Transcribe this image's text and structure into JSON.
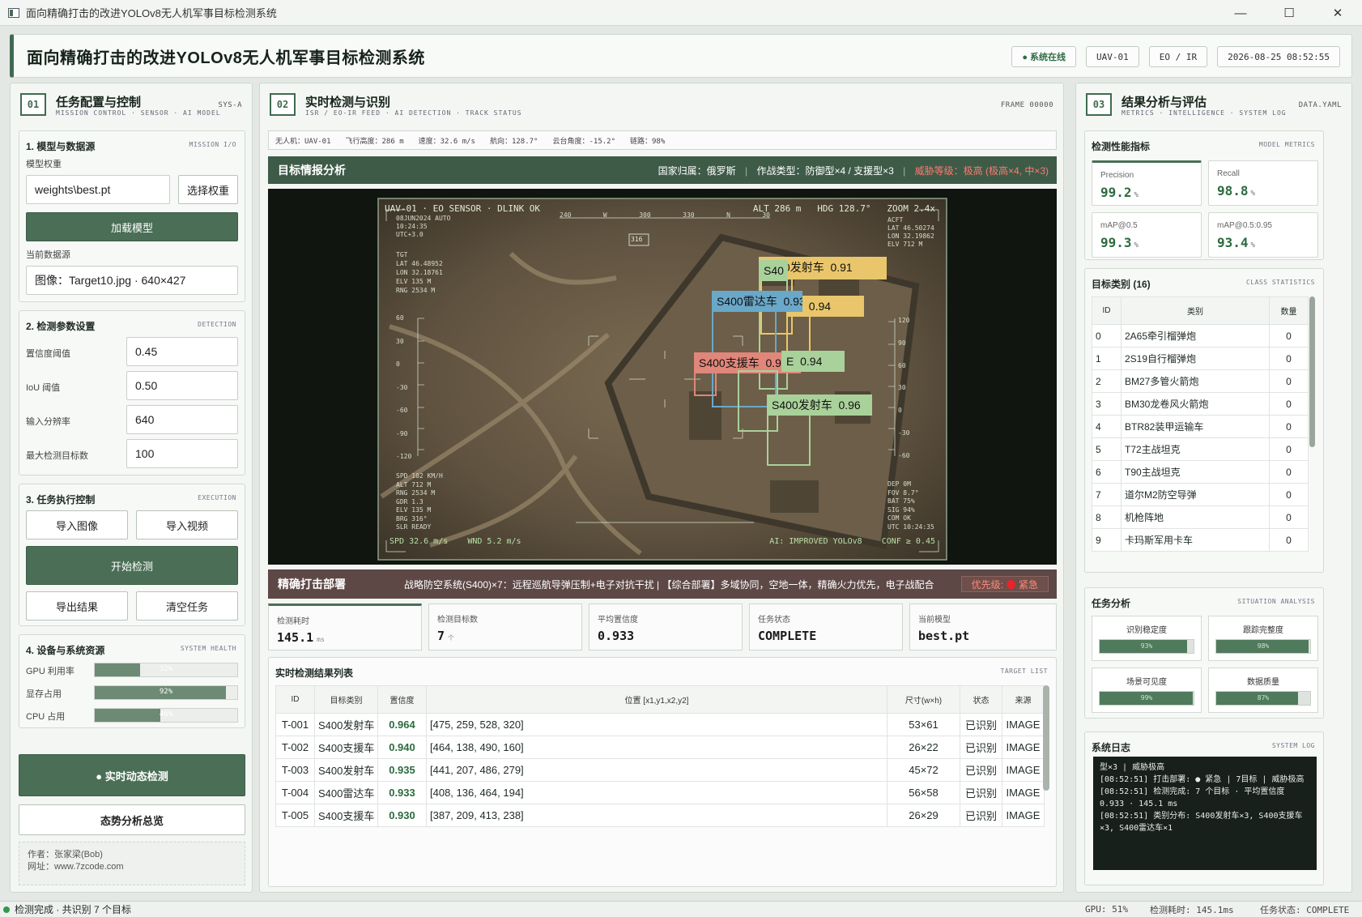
{
  "window": {
    "title": "面向精确打击的改进YOLOv8无人机军事目标检测系统"
  },
  "header": {
    "title": "面向精确打击的改进YOLOv8无人机军事目标检测系统",
    "online": "● 系统在线",
    "uav": "UAV-01",
    "sensor": "EO / IR",
    "datetime": "2026-08-25 08:52:55"
  },
  "left": {
    "num": "01",
    "title": "任务配置与控制",
    "sub": "MISSION CONTROL · SENSOR · AI MODEL",
    "tag": "SYS-A",
    "model": {
      "title": "1. 模型与数据源",
      "tag": "MISSION I/O",
      "weight_label": "模型权重",
      "weight_value": "weights\\best.pt",
      "choose_btn": "选择权重",
      "load_btn": "加载模型",
      "source_label": "当前数据源",
      "source_value": "图像：Target10.jpg · 640×427"
    },
    "params": {
      "title": "2. 检测参数设置",
      "tag": "DETECTION",
      "conf_label": "置信度阈值",
      "conf": "0.45",
      "iou_label": "IoU 阈值",
      "iou": "0.50",
      "res_label": "输入分辨率",
      "res": "640",
      "max_label": "最大检测目标数",
      "max": "100"
    },
    "exec": {
      "title": "3. 任务执行控制",
      "tag": "EXECUTION",
      "import_img": "导入图像",
      "import_vid": "导入视频",
      "start": "开始检测",
      "export": "导出结果",
      "clear": "清空任务"
    },
    "sys": {
      "title": "4. 设备与系统资源",
      "tag": "SYSTEM HEALTH",
      "gpu_label": "GPU 利用率",
      "gpu": "32%",
      "gpu_v": 0.32,
      "vram_label": "显存占用",
      "vram": "92%",
      "vram_v": 0.92,
      "cpu_label": "CPU 占用",
      "cpu": "46%",
      "cpu_v": 0.46
    },
    "realtime": "● 实时动态检测",
    "situation": "态势分析总览",
    "author": "作者：张家梁(Bob)",
    "site": "网址：www.7zcode.com"
  },
  "center": {
    "num": "02",
    "title": "实时检测与识别",
    "sub": "ISR / EO-IR FEED · AI DETECTION · TRACK STATUS",
    "tag": "FRAME 00000",
    "telemetry": [
      "无人机：UAV-01",
      "飞行高度：286 m",
      "速度：32.6 m/s",
      "航向：128.7°",
      "云台角度：-15.2°",
      "链路：98%"
    ],
    "intel": {
      "title": "目标情报分析",
      "country": "国家归属：俄罗斯",
      "types": "作战类型：防御型×4 / 支援型×3",
      "threat": "威胁等级：极高 (极高×4, 中×3)"
    },
    "hud": {
      "top_left": "UAV-01 · EO SENSOR · DLINK OK",
      "top_right": "ALT 286 m   HDG 128.7°   ZOOM 2.4x",
      "date": "08JUN2024  AUTO",
      "time": "10:24:35",
      "utc": "UTC+3.0",
      "tgt": [
        "TGT",
        "LAT  46.48952",
        "LON  32.18761",
        "ELV  135 M",
        "RNG  2534 M"
      ],
      "acft": [
        "ACFT",
        "LAT  46.50274",
        "LON  32.19862",
        "ELV   712 M"
      ],
      "spd_block": [
        "SPD  102 KM/H",
        "ALT  712 M",
        "RNG  2534 M",
        "GDR  1.3",
        "ELV  135 M",
        "BRG  316°",
        "SLR  READY"
      ],
      "dep_block": [
        "DEP  0M",
        "FOV  8.7°",
        "BAT  75%",
        "SIG  94%",
        "COM  OK",
        "UTC  10:24:35"
      ],
      "bottom_left": "SPD 32.6 m/s    WND 5.2 m/s",
      "bottom_right": "AI: IMPROVED YOLOv8    CONF ≥ 0.45",
      "bearing": "316",
      "compass": [
        "240",
        "W",
        "300",
        "330",
        "N",
        "30"
      ],
      "pitch_left": [
        "60",
        "30",
        "0",
        "-30",
        "-60",
        "-90",
        "-120"
      ],
      "pitch_right": [
        "120",
        "90",
        "60",
        "30",
        "0",
        "-30",
        "-60"
      ]
    },
    "detections": [
      {
        "label": "S400发射车  0.91",
        "color": "#e9c66b"
      },
      {
        "label": "S40",
        "color": "#a9d19a"
      },
      {
        "label": "车  0.94",
        "color": "#e9c66b"
      },
      {
        "label": "S400雷达车  0.93",
        "color": "#6aa8c9"
      },
      {
        "label": "S400支援车  0.93",
        "color": "#e0867a"
      },
      {
        "label": "E  0.94",
        "color": "#a9d19a"
      },
      {
        "label": "S400发射车  0.96",
        "color": "#a9d19a"
      }
    ],
    "strike": {
      "title": "精确打击部署",
      "text": "战略防空系统(S400)×7：远程巡航导弹压制+电子对抗干扰 | 【综合部署】多域协同，空地一体，精确火力优先，电子战配合",
      "priority_label": "优先级:",
      "priority": "紧急"
    },
    "stats": [
      {
        "k": "检测耗时",
        "v": "145.1",
        "u": "ms"
      },
      {
        "k": "检测目标数",
        "v": "7",
        "u": "个"
      },
      {
        "k": "平均置信度",
        "v": "0.933",
        "u": ""
      },
      {
        "k": "任务状态",
        "v": "COMPLETE",
        "u": ""
      },
      {
        "k": "当前模型",
        "v": "best.pt",
        "u": ""
      }
    ],
    "results": {
      "title": "实时检测结果列表",
      "tag": "TARGET LIST",
      "headers": [
        "ID",
        "目标类别",
        "置信度",
        "位置 [x1,y1,x2,y2]",
        "尺寸(w×h)",
        "状态",
        "来源"
      ],
      "rows": [
        [
          "T-001",
          "S400发射车",
          "0.964",
          "[475, 259, 528, 320]",
          "53×61",
          "已识别",
          "IMAGE"
        ],
        [
          "T-002",
          "S400支援车",
          "0.940",
          "[464, 138, 490, 160]",
          "26×22",
          "已识别",
          "IMAGE"
        ],
        [
          "T-003",
          "S400发射车",
          "0.935",
          "[441, 207, 486, 279]",
          "45×72",
          "已识别",
          "IMAGE"
        ],
        [
          "T-004",
          "S400雷达车",
          "0.933",
          "[408, 136, 464, 194]",
          "56×58",
          "已识别",
          "IMAGE"
        ],
        [
          "T-005",
          "S400支援车",
          "0.930",
          "[387, 209, 413, 238]",
          "26×29",
          "已识别",
          "IMAGE"
        ]
      ]
    }
  },
  "right": {
    "num": "03",
    "title": "结果分析与评估",
    "sub": "METRICS · INTELLIGENCE · SYSTEM LOG",
    "tag": "DATA.YAML",
    "metrics": {
      "title": "检测性能指标",
      "tag": "MODEL METRICS",
      "items": [
        {
          "k": "Precision",
          "v": "99.2"
        },
        {
          "k": "Recall",
          "v": "98.8"
        },
        {
          "k": "mAP@0.5",
          "v": "99.3"
        },
        {
          "k": "mAP@0.5:0.95",
          "v": "93.4"
        }
      ],
      "unit": "%"
    },
    "classes": {
      "title": "目标类别 (16)",
      "tag": "CLASS STATISTICS",
      "headers": [
        "ID",
        "类别",
        "数量"
      ],
      "rows": [
        [
          "0",
          "2A65牵引榴弹炮",
          "0"
        ],
        [
          "1",
          "2S19自行榴弹炮",
          "0"
        ],
        [
          "2",
          "BM27多管火箭炮",
          "0"
        ],
        [
          "3",
          "BM30龙卷风火箭炮",
          "0"
        ],
        [
          "4",
          "BTR82装甲运输车",
          "0"
        ],
        [
          "5",
          "T72主战坦克",
          "0"
        ],
        [
          "6",
          "T90主战坦克",
          "0"
        ],
        [
          "7",
          "道尔M2防空导弹",
          "0"
        ],
        [
          "8",
          "机枪阵地",
          "0"
        ],
        [
          "9",
          "卡玛斯军用卡车",
          "0"
        ]
      ]
    },
    "analysis": {
      "title": "任务分析",
      "tag": "SITUATION ANALYSIS",
      "items": [
        {
          "k": "识别稳定度",
          "t": "93%",
          "v": 0.93
        },
        {
          "k": "跟踪完整度",
          "t": "98%",
          "v": 0.98
        },
        {
          "k": "场景可见度",
          "t": "99%",
          "v": 0.99
        },
        {
          "k": "数据质量",
          "t": "87%",
          "v": 0.87
        }
      ]
    },
    "log": {
      "title": "系统日志",
      "tag": "SYSTEM LOG",
      "lines": [
        "型×3 | 威胁极高",
        "[08:52:51] 打击部署: ● 紧急 | 7目标 | 威胁极高",
        "[08:52:51] 检测完成: 7 个目标 · 平均置信度 0.933 · 145.1 ms",
        "[08:52:51] 类别分布: S400发射车×3, S400支援车×3, S400雷达车×1"
      ]
    }
  },
  "statusbar": {
    "left": "检测完成 · 共识别 7 个目标",
    "gpu": "GPU: 51%",
    "time": "检测耗时: 145.1ms",
    "state": "任务状态: COMPLETE"
  }
}
